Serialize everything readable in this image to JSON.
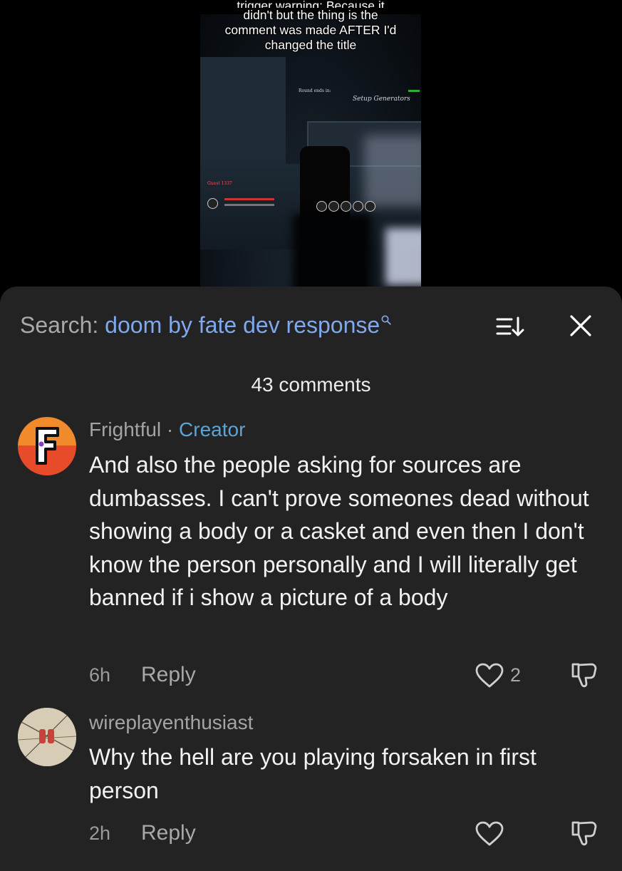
{
  "video": {
    "caption_cut": "trigger warning: Because it",
    "caption_lines": [
      "didn't but the thing is the",
      "comment was made AFTER I'd",
      "changed the title"
    ],
    "hud_round": "Round ends in:",
    "hud_objective": "Setup Generators",
    "hud_player": "Guest 1337"
  },
  "comments_panel": {
    "search_label": "Search:",
    "search_query": "doom by fate dev response",
    "comment_count": "43 comments"
  },
  "comments": [
    {
      "username": "Frightful",
      "separator": " · ",
      "badge": "Creator",
      "text": "And also the people asking for sources are dumbasses. I can't prove someones dead without showing a body or a casket and even then I don't know the person personally and I will literally get banned if i show a picture of a body",
      "time": "6h",
      "reply_label": "Reply",
      "likes": "2",
      "avatar_letter": "F"
    },
    {
      "username": "wireplayenthusiast",
      "text": "Why the hell are you playing forsaken in first person",
      "time": "2h",
      "reply_label": "Reply",
      "likes": ""
    }
  ],
  "icons": {
    "search": "magnifier-icon",
    "sort": "sort-icon",
    "close": "close-icon",
    "like": "heart-icon",
    "dislike": "thumbs-down-icon"
  },
  "colors": {
    "sheet_bg": "#232323",
    "query_blue": "#7fa9ec",
    "creator_blue": "#5aa5d6",
    "avatar_orange": "#f08a2a",
    "avatar_red": "#e84b2a"
  }
}
